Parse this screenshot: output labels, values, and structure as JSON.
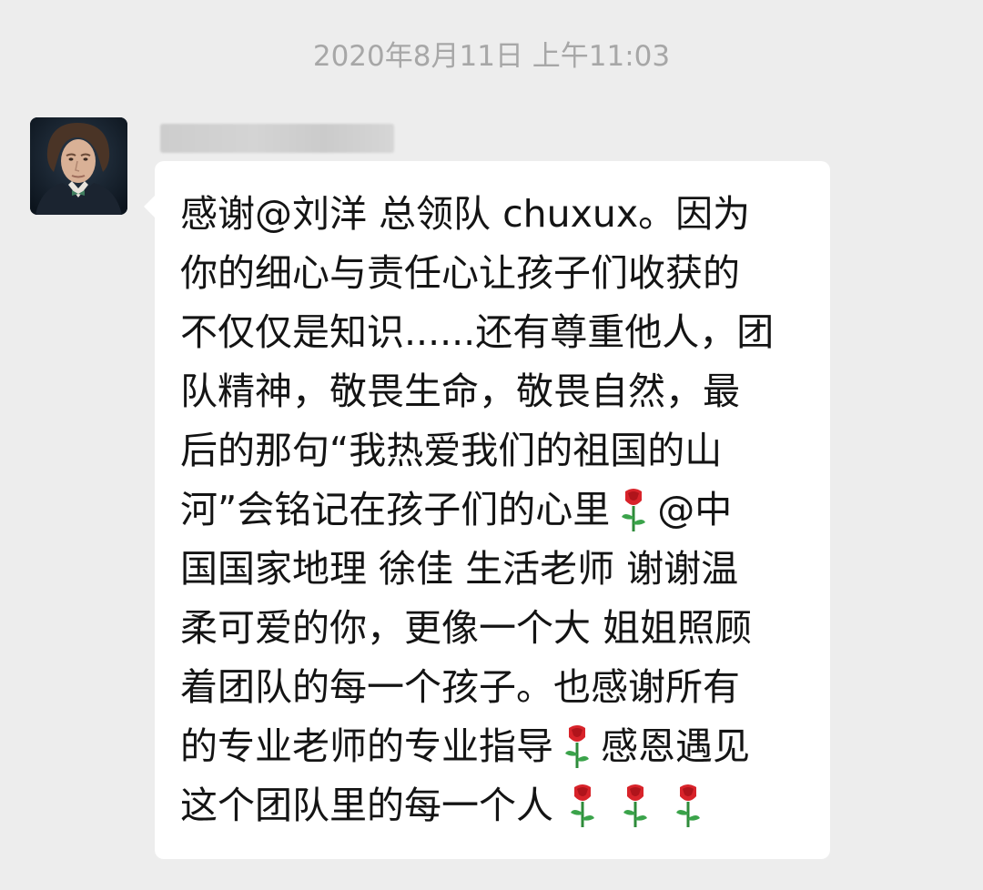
{
  "chat": {
    "timestamp": "2020年8月11日 上午11:03"
  },
  "message": {
    "avatar_icon": "user-avatar-portrait",
    "sender_name_redacted": true,
    "emoji": "rose",
    "lines": [
      [
        "感谢@刘洋  总领队  chuxux。因为"
      ],
      [
        "你的细心与责任心让孩子们收获的"
      ],
      [
        "不仅仅是知识......还有尊重他人，团"
      ],
      [
        "队精神，敬畏生命，敬畏自然，最"
      ],
      [
        "后的那句“我热爱我们的祖国的山"
      ],
      [
        "河”会铭记在孩子们的心里",
        "@中"
      ],
      [
        "国国家地理 徐佳 生活老师  谢谢温"
      ],
      [
        "柔可爱的你，更像一个大 姐姐照顾"
      ],
      [
        "着团队的每一个孩子。也感谢所有"
      ],
      [
        "的专业老师的专业指导",
        "感恩遇见"
      ],
      [
        "这个团队里的每一个人"
      ]
    ]
  }
}
